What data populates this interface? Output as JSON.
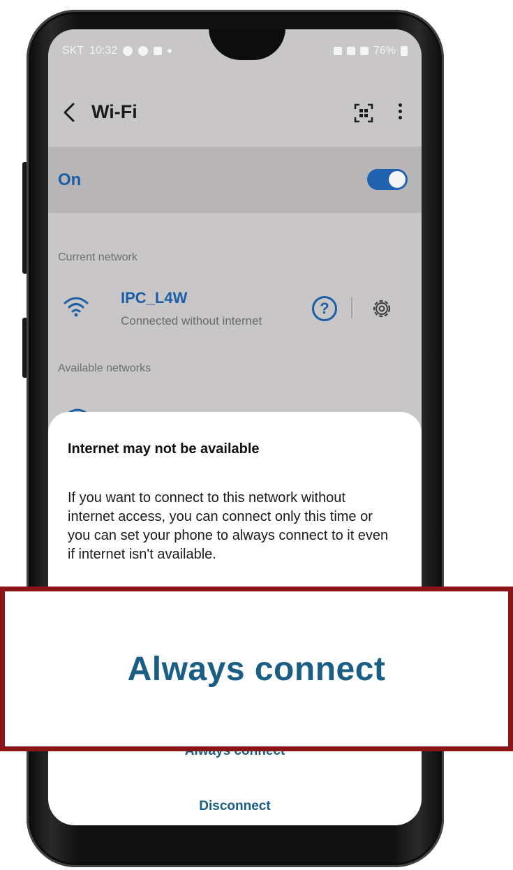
{
  "status_bar": {
    "carrier": "SKT",
    "time": "10:32",
    "battery": "76%"
  },
  "toolbar": {
    "title": "Wi-Fi"
  },
  "wifi_toggle": {
    "label": "On",
    "state": "on"
  },
  "sections": {
    "current": "Current network",
    "available": "Available networks"
  },
  "current_network": {
    "name": "IPC_L4W",
    "status": "Connected without internet",
    "help_glyph": "?"
  },
  "dialog": {
    "title": "Internet may not be available",
    "body": "If you want to connect to this network without internet access, you can connect only this time or you can set your phone to always connect to it even if internet isn't available.",
    "always_connect": "Always connect",
    "disconnect": "Disconnect"
  },
  "callout": {
    "text": "Always connect"
  },
  "colors": {
    "accent_blue": "#1a5ea8",
    "action_teal": "#1a5e85",
    "callout_border": "#8b1518",
    "screen_bg": "#c8c6c7"
  }
}
